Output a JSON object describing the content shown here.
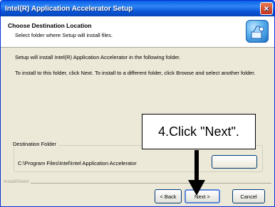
{
  "window": {
    "title": "Intel(R) Application Accelerator Setup",
    "close_label": "×"
  },
  "header": {
    "title": "Choose Destination Location",
    "subtitle": "Select folder where Setup will install files.",
    "icon": "setup-wizard-icon"
  },
  "body": {
    "line1": "Setup will install Intel(R) Application Accelerator in the following folder.",
    "line2": "To install to this folder, click Next. To install to a different folder, click Browse and select another folder."
  },
  "destination": {
    "label": "Destination Folder",
    "path": "C:\\Program Files\\Intel\\Intel Application Accelerator",
    "browse_label": ""
  },
  "footer": {
    "brand": "InstallShield",
    "back_label": "< Back",
    "next_label": "Next >",
    "cancel_label": "Cancel"
  },
  "annotation": {
    "text": "4.Click \"Next\"."
  },
  "colors": {
    "titlebar": "#0a54d6",
    "window_bg": "#ece9d8",
    "callout_border": "#000000"
  }
}
